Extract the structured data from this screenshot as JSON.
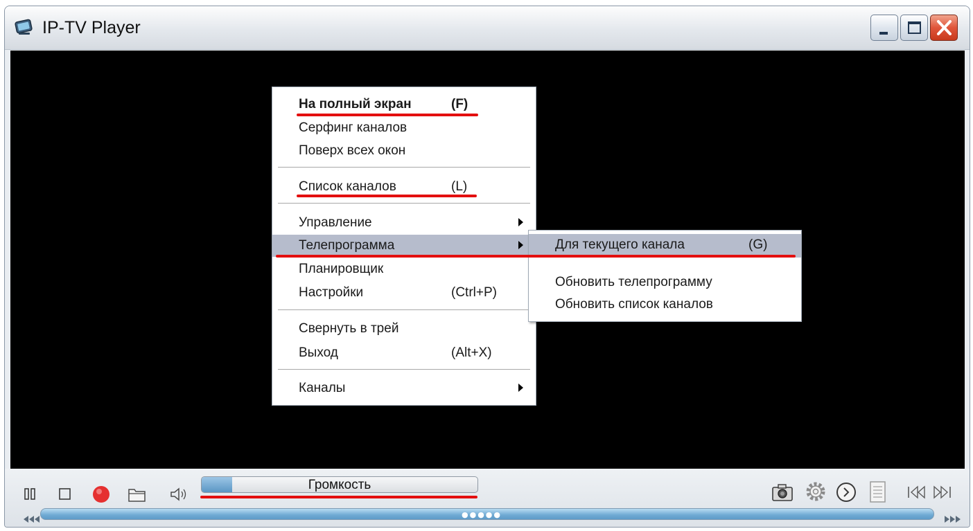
{
  "window": {
    "title": "IP-TV Player",
    "controls": [
      "minimize-button",
      "maximize-button",
      "close-button"
    ]
  },
  "context_menu": {
    "items": [
      {
        "label": "На полный экран",
        "shortcut": "(F)",
        "bold": true
      },
      {
        "label": "Серфинг каналов",
        "shortcut": ""
      },
      {
        "label": "Поверх всех окон",
        "shortcut": ""
      },
      {
        "label": "Список каналов",
        "shortcut": "(L)"
      },
      {
        "label": "Управление",
        "shortcut": "",
        "submenu": true
      },
      {
        "label": "Телепрограмма",
        "shortcut": "",
        "submenu": true,
        "highlighted": true
      },
      {
        "label": "Планировщик",
        "shortcut": ""
      },
      {
        "label": "Настройки",
        "shortcut": "(Ctrl+P)"
      },
      {
        "label": "Свернуть в трей",
        "shortcut": ""
      },
      {
        "label": "Выход",
        "shortcut": "(Alt+X)"
      },
      {
        "label": "Каналы",
        "shortcut": "",
        "submenu": true
      }
    ]
  },
  "submenu": {
    "items": [
      {
        "label": "Для текущего канала",
        "shortcut": "(G)",
        "highlighted": true
      },
      {
        "label": "Обновить телепрограмму",
        "shortcut": ""
      },
      {
        "label": "Обновить список каналов",
        "shortcut": ""
      }
    ]
  },
  "toolbar": {
    "left_buttons": [
      "pause-icon",
      "stop-icon",
      "record-icon",
      "folder-icon",
      "speaker-icon"
    ],
    "right_buttons": [
      "camera-icon",
      "gear-icon",
      "clock-icon",
      "document-icon",
      "previous-channel-icon",
      "next-channel-icon"
    ],
    "volume_label": "Громкость",
    "volume_level": 0.11
  },
  "colors": {
    "highlight_annotation": "#e30f0f",
    "menu_highlight": "#b6bccc",
    "record": "#e53030"
  }
}
